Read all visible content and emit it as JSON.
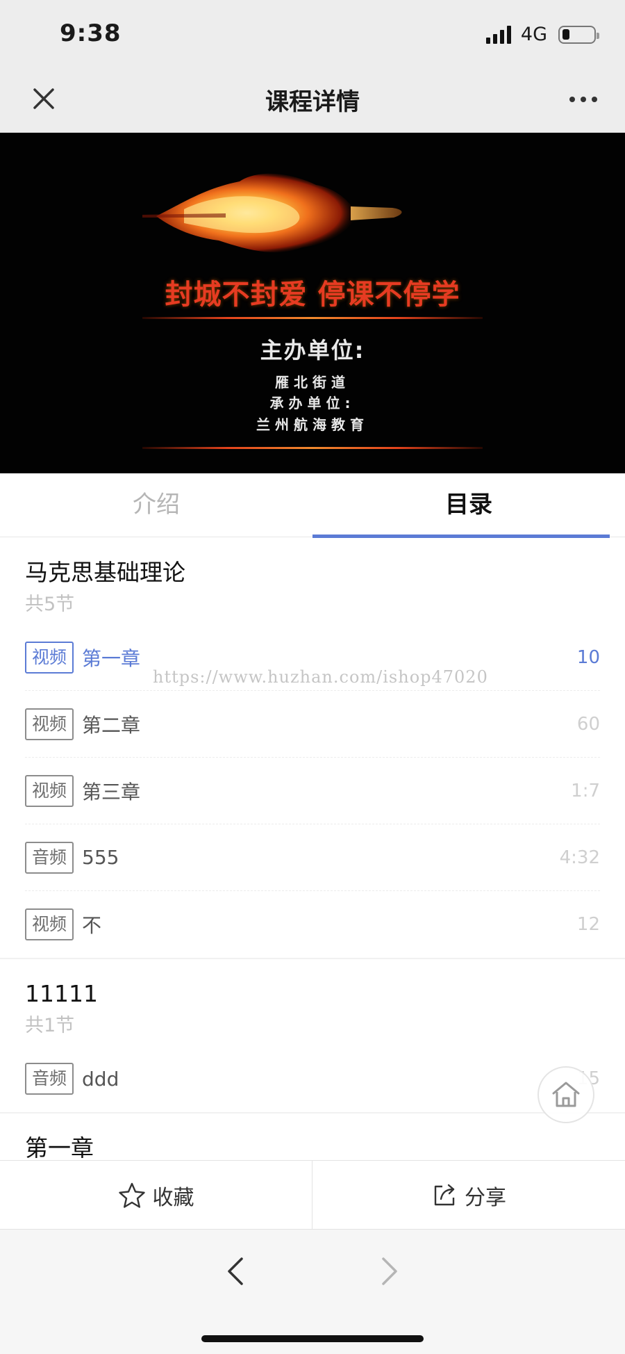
{
  "status_bar": {
    "time": "9:38",
    "network": "4G"
  },
  "nav": {
    "title": "课程详情"
  },
  "banner": {
    "headline": "封城不封爱 停课不停学",
    "host_label": "主办单位:",
    "host": "雁北街道",
    "organizer_label": "承办单位:",
    "organizer": "兰州航海教育"
  },
  "tabs": [
    {
      "label": "介绍",
      "active": false
    },
    {
      "label": "目录",
      "active": true
    }
  ],
  "chapters": [
    {
      "title": "马克思基础理论",
      "count": "共5节",
      "lessons": [
        {
          "tag": "视频",
          "name": "第一章",
          "duration": "10",
          "active": true
        },
        {
          "tag": "视频",
          "name": "第二章",
          "duration": "60",
          "active": false
        },
        {
          "tag": "视频",
          "name": "第三章",
          "duration": "1:7",
          "active": false
        },
        {
          "tag": "音频",
          "name": "555",
          "duration": "4:32",
          "active": false
        },
        {
          "tag": "视频",
          "name": "不",
          "duration": "12",
          "active": false
        }
      ]
    },
    {
      "title": "11111",
      "count": "共1节",
      "lessons": [
        {
          "tag": "音频",
          "name": "ddd",
          "duration": "15",
          "active": false
        }
      ]
    },
    {
      "title": "第一章",
      "count": "",
      "lessons": []
    }
  ],
  "watermark": "https://www.huzhan.com/ishop47020",
  "actions": {
    "favorite": "收藏",
    "share": "分享"
  },
  "colors": {
    "accent": "#5b7bd5",
    "banner_red": "#e63b22"
  },
  "icons": [
    "close-icon",
    "more-icon",
    "home-icon",
    "star-icon",
    "share-icon",
    "back-arrow-icon",
    "forward-arrow-icon"
  ]
}
